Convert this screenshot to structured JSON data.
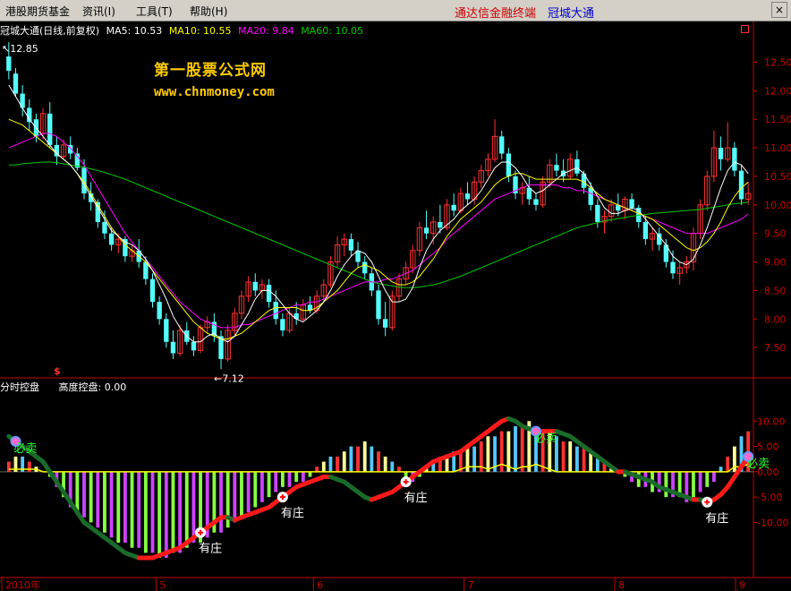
{
  "menu": {
    "items": [
      "港股期货基金",
      "资讯(I)",
      "工具(T)",
      "帮助(H)"
    ],
    "brand_left": "通达信金融终端",
    "brand_right": "冠城大通",
    "close_glyph": "×"
  },
  "main_chart": {
    "title": "冠城大通(日线,前复权)",
    "ma5": "MA5: 10.53",
    "ma10": "MA10: 10.55",
    "ma20": "MA20: 9.84",
    "ma60": "MA60: 10.05",
    "high_marker": "12.85",
    "low_marker": "←7.12",
    "dollar_mark": "$",
    "y_ticks": [
      "12.50",
      "12.00",
      "11.50",
      "11.00",
      "10.50",
      "10.00",
      "9.50",
      "9.00",
      "8.50",
      "8.00",
      "7.50"
    ]
  },
  "watermark": {
    "line1": "第一股票公式网",
    "line2": "www.chnmoney.com"
  },
  "indicator": {
    "name": "分时控盘",
    "height_label": "高度控盘: 0.00",
    "y_ticks": [
      "10.00",
      "5.00",
      "0.00",
      "-5.00",
      "-10.00"
    ],
    "sell_label": "必卖",
    "buy_label": "有庄"
  },
  "x_axis": {
    "labels": [
      "2010年",
      "5",
      "6",
      "7",
      "8",
      "9"
    ]
  },
  "colors": {
    "up": "#ff3232",
    "down": "#54ffff",
    "ma5": "#ffffff",
    "ma10": "#ffff00",
    "ma20": "#ff00ff",
    "ma60": "#00cc00",
    "axis": "#cc0000",
    "brand_left": "#cc0000",
    "brand_right": "#0000cc"
  },
  "chart_data": {
    "type": "candlestick",
    "candles_ohlc": [
      [
        12.6,
        12.85,
        12.2,
        12.35
      ],
      [
        12.3,
        12.4,
        11.9,
        11.95
      ],
      [
        11.95,
        12.1,
        11.55,
        11.7
      ],
      [
        11.7,
        11.85,
        11.3,
        11.45
      ],
      [
        11.5,
        11.6,
        11.1,
        11.2
      ],
      [
        11.25,
        11.7,
        11.15,
        11.6
      ],
      [
        11.6,
        11.8,
        11.0,
        11.05
      ],
      [
        11.05,
        11.2,
        10.7,
        10.85
      ],
      [
        10.85,
        11.15,
        10.8,
        11.05
      ],
      [
        11.05,
        11.2,
        10.8,
        10.9
      ],
      [
        10.9,
        11.0,
        10.6,
        10.65
      ],
      [
        10.65,
        10.8,
        10.1,
        10.2
      ],
      [
        10.2,
        10.4,
        9.9,
        10.05
      ],
      [
        10.05,
        10.1,
        9.6,
        9.7
      ],
      [
        9.7,
        9.9,
        9.4,
        9.5
      ],
      [
        9.5,
        9.6,
        9.2,
        9.3
      ],
      [
        9.3,
        9.5,
        9.15,
        9.4
      ],
      [
        9.4,
        9.45,
        9.0,
        9.1
      ],
      [
        9.1,
        9.3,
        9.0,
        9.2
      ],
      [
        9.2,
        9.4,
        8.9,
        9.0
      ],
      [
        9.0,
        9.1,
        8.6,
        8.7
      ],
      [
        8.7,
        8.8,
        8.2,
        8.3
      ],
      [
        8.3,
        8.4,
        7.9,
        8.0
      ],
      [
        8.0,
        8.1,
        7.5,
        7.6
      ],
      [
        7.6,
        7.8,
        7.3,
        7.4
      ],
      [
        7.4,
        7.9,
        7.35,
        7.8
      ],
      [
        7.8,
        7.95,
        7.55,
        7.6
      ],
      [
        7.6,
        7.7,
        7.35,
        7.45
      ],
      [
        7.45,
        7.9,
        7.4,
        7.85
      ],
      [
        7.85,
        8.05,
        7.75,
        7.95
      ],
      [
        7.95,
        8.1,
        7.6,
        7.7
      ],
      [
        7.7,
        7.8,
        7.12,
        7.3
      ],
      [
        7.3,
        7.9,
        7.25,
        7.8
      ],
      [
        7.8,
        8.2,
        7.7,
        8.1
      ],
      [
        8.1,
        8.5,
        8.0,
        8.4
      ],
      [
        8.4,
        8.75,
        8.3,
        8.65
      ],
      [
        8.65,
        8.8,
        8.4,
        8.5
      ],
      [
        8.5,
        8.7,
        8.35,
        8.6
      ],
      [
        8.6,
        8.7,
        8.2,
        8.3
      ],
      [
        8.3,
        8.5,
        7.9,
        8.0
      ],
      [
        8.0,
        8.1,
        7.7,
        7.8
      ],
      [
        7.8,
        8.2,
        7.75,
        8.1
      ],
      [
        8.1,
        8.3,
        7.9,
        8.0
      ],
      [
        8.0,
        8.35,
        7.95,
        8.25
      ],
      [
        8.25,
        8.4,
        8.1,
        8.15
      ],
      [
        8.15,
        8.5,
        8.1,
        8.4
      ],
      [
        8.4,
        8.7,
        8.3,
        8.6
      ],
      [
        8.6,
        9.1,
        8.55,
        9.0
      ],
      [
        9.0,
        9.45,
        8.9,
        9.3
      ],
      [
        9.3,
        9.5,
        9.1,
        9.4
      ],
      [
        9.4,
        9.5,
        9.1,
        9.2
      ],
      [
        9.2,
        9.35,
        8.9,
        9.0
      ],
      [
        9.0,
        9.1,
        8.7,
        8.8
      ],
      [
        8.8,
        8.9,
        8.4,
        8.5
      ],
      [
        8.5,
        8.6,
        7.9,
        8.0
      ],
      [
        8.0,
        8.3,
        7.7,
        7.85
      ],
      [
        7.85,
        8.5,
        7.8,
        8.4
      ],
      [
        8.4,
        8.8,
        8.3,
        8.7
      ],
      [
        8.7,
        9.0,
        8.6,
        8.9
      ],
      [
        8.9,
        9.3,
        8.8,
        9.2
      ],
      [
        9.2,
        9.7,
        9.1,
        9.6
      ],
      [
        9.6,
        9.9,
        9.4,
        9.5
      ],
      [
        9.5,
        9.8,
        9.3,
        9.7
      ],
      [
        9.7,
        10.0,
        9.5,
        9.6
      ],
      [
        9.6,
        10.1,
        9.55,
        10.0
      ],
      [
        10.0,
        10.2,
        9.8,
        9.9
      ],
      [
        9.9,
        10.3,
        9.85,
        10.2
      ],
      [
        10.2,
        10.4,
        10.0,
        10.1
      ],
      [
        10.1,
        10.5,
        10.0,
        10.4
      ],
      [
        10.4,
        10.7,
        10.3,
        10.6
      ],
      [
        10.6,
        10.9,
        10.5,
        10.8
      ],
      [
        10.8,
        11.5,
        10.75,
        11.2
      ],
      [
        11.2,
        11.3,
        10.8,
        10.9
      ],
      [
        10.9,
        11.0,
        10.4,
        10.5
      ],
      [
        10.5,
        10.6,
        10.1,
        10.2
      ],
      [
        10.2,
        10.4,
        10.0,
        10.3
      ],
      [
        10.3,
        10.5,
        10.0,
        10.1
      ],
      [
        10.1,
        10.2,
        9.9,
        10.0
      ],
      [
        10.0,
        10.5,
        9.95,
        10.4
      ],
      [
        10.4,
        10.8,
        10.3,
        10.7
      ],
      [
        10.7,
        10.9,
        10.5,
        10.6
      ],
      [
        10.6,
        10.8,
        10.4,
        10.5
      ],
      [
        10.5,
        10.9,
        10.45,
        10.8
      ],
      [
        10.8,
        10.95,
        10.5,
        10.55
      ],
      [
        10.55,
        10.6,
        10.2,
        10.3
      ],
      [
        10.3,
        10.4,
        9.9,
        10.0
      ],
      [
        10.0,
        10.1,
        9.6,
        9.7
      ],
      [
        9.7,
        9.9,
        9.5,
        9.8
      ],
      [
        9.8,
        10.1,
        9.7,
        10.0
      ],
      [
        10.0,
        10.2,
        9.8,
        9.9
      ],
      [
        9.9,
        10.15,
        9.75,
        10.1
      ],
      [
        10.1,
        10.2,
        9.9,
        9.95
      ],
      [
        9.95,
        10.0,
        9.6,
        9.7
      ],
      [
        9.7,
        9.8,
        9.3,
        9.4
      ],
      [
        9.4,
        9.6,
        9.2,
        9.5
      ],
      [
        9.5,
        9.6,
        9.2,
        9.3
      ],
      [
        9.3,
        9.4,
        8.9,
        9.0
      ],
      [
        9.0,
        9.2,
        8.7,
        8.8
      ],
      [
        8.8,
        9.0,
        8.6,
        8.9
      ],
      [
        8.9,
        9.1,
        8.8,
        9.0
      ],
      [
        9.0,
        9.6,
        8.85,
        9.5
      ],
      [
        9.5,
        10.1,
        9.4,
        10.0
      ],
      [
        10.0,
        10.6,
        9.9,
        10.5
      ],
      [
        10.5,
        11.3,
        10.4,
        11.0
      ],
      [
        11.0,
        11.2,
        10.6,
        10.8
      ],
      [
        10.8,
        11.45,
        10.75,
        11.0
      ],
      [
        11.0,
        11.1,
        10.5,
        10.6
      ],
      [
        10.6,
        10.7,
        10.0,
        10.1
      ],
      [
        10.1,
        10.4,
        10.0,
        10.2
      ]
    ],
    "ma5": [
      12.1,
      11.9,
      11.7,
      11.5,
      11.35,
      11.2,
      11.05,
      10.9,
      10.8,
      10.7,
      10.55,
      10.35,
      10.15,
      9.95,
      9.75,
      9.55,
      9.45,
      9.35,
      9.3,
      9.2,
      9.05,
      8.85,
      8.6,
      8.35,
      8.05,
      7.85,
      7.7,
      7.6,
      7.6,
      7.7,
      7.75,
      7.65,
      7.6,
      7.7,
      7.9,
      8.1,
      8.35,
      8.5,
      8.5,
      8.4,
      8.25,
      8.1,
      8.0,
      7.95,
      8.05,
      8.15,
      8.3,
      8.5,
      8.75,
      8.95,
      9.1,
      9.2,
      9.15,
      9.0,
      8.75,
      8.5,
      8.3,
      8.3,
      8.35,
      8.55,
      8.9,
      9.2,
      9.4,
      9.55,
      9.65,
      9.75,
      9.9,
      10.0,
      10.1,
      10.25,
      10.45,
      10.65,
      10.75,
      10.75,
      10.65,
      10.5,
      10.3,
      10.2,
      10.25,
      10.35,
      10.45,
      10.55,
      10.6,
      10.65,
      10.55,
      10.35,
      10.15,
      9.95,
      9.85,
      9.85,
      9.9,
      9.95,
      9.9,
      9.75,
      9.6,
      9.45,
      9.3,
      9.1,
      9.0,
      8.95,
      9.05,
      9.3,
      9.6,
      9.95,
      10.3,
      10.6,
      10.75,
      10.7,
      10.55
    ],
    "ma10": [
      11.5,
      11.45,
      11.4,
      11.3,
      11.2,
      11.1,
      11.0,
      10.9,
      10.8,
      10.7,
      10.55,
      10.4,
      10.2,
      10.0,
      9.8,
      9.6,
      9.45,
      9.3,
      9.2,
      9.1,
      9.0,
      8.85,
      8.7,
      8.55,
      8.4,
      8.25,
      8.1,
      7.95,
      7.85,
      7.75,
      7.7,
      7.65,
      7.65,
      7.7,
      7.75,
      7.85,
      7.95,
      8.05,
      8.15,
      8.2,
      8.2,
      8.2,
      8.2,
      8.15,
      8.15,
      8.2,
      8.3,
      8.4,
      8.5,
      8.65,
      8.8,
      8.9,
      8.95,
      8.9,
      8.85,
      8.75,
      8.65,
      8.6,
      8.6,
      8.65,
      8.75,
      8.9,
      9.05,
      9.25,
      9.45,
      9.6,
      9.75,
      9.85,
      9.95,
      10.05,
      10.2,
      10.35,
      10.45,
      10.5,
      10.55,
      10.55,
      10.5,
      10.45,
      10.45,
      10.45,
      10.45,
      10.45,
      10.45,
      10.45,
      10.4,
      10.3,
      10.2,
      10.1,
      10.05,
      10.0,
      9.95,
      9.9,
      9.85,
      9.8,
      9.75,
      9.65,
      9.55,
      9.45,
      9.35,
      9.25,
      9.2,
      9.25,
      9.35,
      9.5,
      9.7,
      9.95,
      10.15,
      10.3,
      10.4
    ],
    "ma20": [
      11.0,
      11.05,
      11.1,
      11.15,
      11.2,
      11.25,
      11.25,
      11.2,
      11.1,
      11.0,
      10.85,
      10.7,
      10.5,
      10.3,
      10.1,
      9.9,
      9.7,
      9.5,
      9.35,
      9.2,
      9.05,
      8.9,
      8.75,
      8.6,
      8.45,
      8.3,
      8.2,
      8.1,
      8.0,
      7.95,
      7.9,
      7.85,
      7.85,
      7.85,
      7.9,
      7.9,
      7.95,
      8.0,
      8.05,
      8.1,
      8.15,
      8.2,
      8.25,
      8.25,
      8.3,
      8.3,
      8.35,
      8.4,
      8.45,
      8.5,
      8.55,
      8.6,
      8.65,
      8.65,
      8.65,
      8.7,
      8.7,
      8.75,
      8.8,
      8.85,
      8.95,
      9.05,
      9.15,
      9.25,
      9.4,
      9.5,
      9.6,
      9.7,
      9.8,
      9.9,
      10.0,
      10.1,
      10.15,
      10.2,
      10.25,
      10.3,
      10.35,
      10.35,
      10.35,
      10.35,
      10.35,
      10.3,
      10.3,
      10.25,
      10.25,
      10.2,
      10.15,
      10.1,
      10.05,
      10.0,
      9.95,
      9.9,
      9.85,
      9.8,
      9.75,
      9.7,
      9.65,
      9.6,
      9.55,
      9.5,
      9.5,
      9.5,
      9.5,
      9.55,
      9.6,
      9.65,
      9.7,
      9.75,
      9.84
    ],
    "ma60": [
      10.7,
      10.7,
      10.72,
      10.73,
      10.74,
      10.75,
      10.75,
      10.74,
      10.72,
      10.7,
      10.68,
      10.66,
      10.63,
      10.6,
      10.57,
      10.53,
      10.49,
      10.45,
      10.4,
      10.35,
      10.3,
      10.25,
      10.2,
      10.15,
      10.1,
      10.05,
      10.0,
      9.95,
      9.9,
      9.85,
      9.8,
      9.75,
      9.7,
      9.65,
      9.6,
      9.55,
      9.5,
      9.45,
      9.4,
      9.35,
      9.3,
      9.25,
      9.2,
      9.15,
      9.1,
      9.05,
      9.0,
      8.95,
      8.9,
      8.85,
      8.8,
      8.75,
      8.7,
      8.65,
      8.62,
      8.6,
      8.58,
      8.56,
      8.55,
      8.55,
      8.56,
      8.58,
      8.6,
      8.63,
      8.67,
      8.71,
      8.75,
      8.8,
      8.85,
      8.9,
      8.95,
      9.0,
      9.05,
      9.1,
      9.15,
      9.2,
      9.25,
      9.3,
      9.35,
      9.4,
      9.45,
      9.5,
      9.55,
      9.6,
      9.63,
      9.66,
      9.69,
      9.72,
      9.74,
      9.76,
      9.78,
      9.8,
      9.82,
      9.83,
      9.85,
      9.86,
      9.87,
      9.88,
      9.89,
      9.9,
      9.91,
      9.92,
      9.94,
      9.96,
      9.98,
      10.0,
      10.02,
      10.03,
      10.05
    ],
    "ylim": [
      7.0,
      12.9
    ],
    "indicator_hist": [
      2,
      3,
      3,
      2,
      1,
      0,
      -1,
      -3,
      -5,
      -7,
      -8,
      -9,
      -10,
      -11,
      -12,
      -13,
      -14,
      -14,
      -15,
      -15,
      -16,
      -16,
      -17,
      -17,
      -16,
      -16,
      -15,
      -14,
      -14,
      -13,
      -12,
      -12,
      -11,
      -10,
      -9,
      -8,
      -7,
      -6,
      -5,
      -4,
      -3,
      -3,
      -2,
      -2,
      -1,
      1,
      2,
      3,
      3,
      4,
      5,
      5,
      6,
      5,
      4,
      3,
      2,
      1,
      -1,
      -2,
      -1,
      1,
      2,
      3,
      3,
      4,
      4,
      5,
      5,
      6,
      7,
      7,
      8,
      8,
      9,
      9,
      10,
      9,
      8,
      8,
      7,
      6,
      6,
      5,
      5,
      4,
      3,
      2,
      1,
      0,
      -1,
      -2,
      -3,
      -3,
      -4,
      -4,
      -5,
      -5,
      -5,
      -6,
      -5,
      -4,
      -3,
      -2,
      1,
      3,
      5,
      7,
      8,
      8,
      8,
      7,
      7
    ],
    "indicator_line": [
      7,
      6,
      5,
      4,
      3,
      2,
      0,
      -2,
      -4,
      -6,
      -8,
      -10,
      -11,
      -12,
      -13,
      -14,
      -15,
      -16,
      -16.5,
      -17,
      -17,
      -17,
      -16.5,
      -16,
      -15.5,
      -15,
      -14,
      -13,
      -12,
      -11,
      -10,
      -9,
      -9,
      -9.5,
      -9,
      -8.5,
      -8,
      -7.5,
      -7,
      -6,
      -5,
      -4,
      -3,
      -2.5,
      -2,
      -1.5,
      -1,
      -1,
      -1.5,
      -2,
      -3,
      -4,
      -5,
      -5.5,
      -5,
      -4.5,
      -4,
      -3,
      -2,
      -1,
      0,
      1,
      2,
      2.5,
      3,
      3.5,
      4,
      5,
      6,
      7,
      8,
      9,
      10,
      10.5,
      10,
      9,
      8.5,
      8,
      8,
      8,
      8,
      7.5,
      7,
      6,
      5,
      4,
      3,
      2,
      1,
      0,
      0,
      -0.5,
      -1,
      -1.5,
      -2,
      -3,
      -3.5,
      -4,
      -4.5,
      -5,
      -5.5,
      -5.5,
      -6,
      -5.5,
      -4.5,
      -3,
      -1,
      1,
      3,
      5,
      6,
      7,
      7.5,
      7
    ],
    "indicator_yellow": [
      0.5,
      0.5,
      0.5,
      0.5,
      0.5,
      0,
      0,
      0,
      0,
      0,
      0,
      0,
      0,
      0,
      0,
      0,
      0,
      0,
      0,
      0,
      0,
      0,
      0,
      0,
      0,
      0,
      0,
      0,
      0,
      0,
      0,
      0,
      0,
      0,
      0,
      0,
      0,
      0,
      0,
      0,
      0,
      0,
      0,
      0,
      0,
      0,
      0,
      0,
      0,
      0,
      0,
      0,
      0,
      0,
      0,
      0,
      0,
      0,
      0,
      0,
      0,
      0,
      0,
      0,
      0,
      0,
      0.5,
      1,
      1,
      1,
      0.5,
      1,
      1.5,
      1,
      0.5,
      1,
      1,
      1.5,
      1,
      0.5,
      0,
      0,
      0,
      0,
      0,
      0,
      0,
      0,
      0,
      0,
      0,
      0,
      0,
      0,
      0,
      0,
      0,
      0,
      0,
      0,
      0,
      0,
      0,
      0,
      0,
      0,
      1,
      1,
      1.5,
      1,
      0.5,
      0.5,
      0.5
    ],
    "indicator_ylim": [
      -20,
      15
    ],
    "sell_signals_idx": [
      1,
      77,
      110
    ],
    "buy_signals_idx": [
      28,
      40,
      58,
      102
    ]
  }
}
